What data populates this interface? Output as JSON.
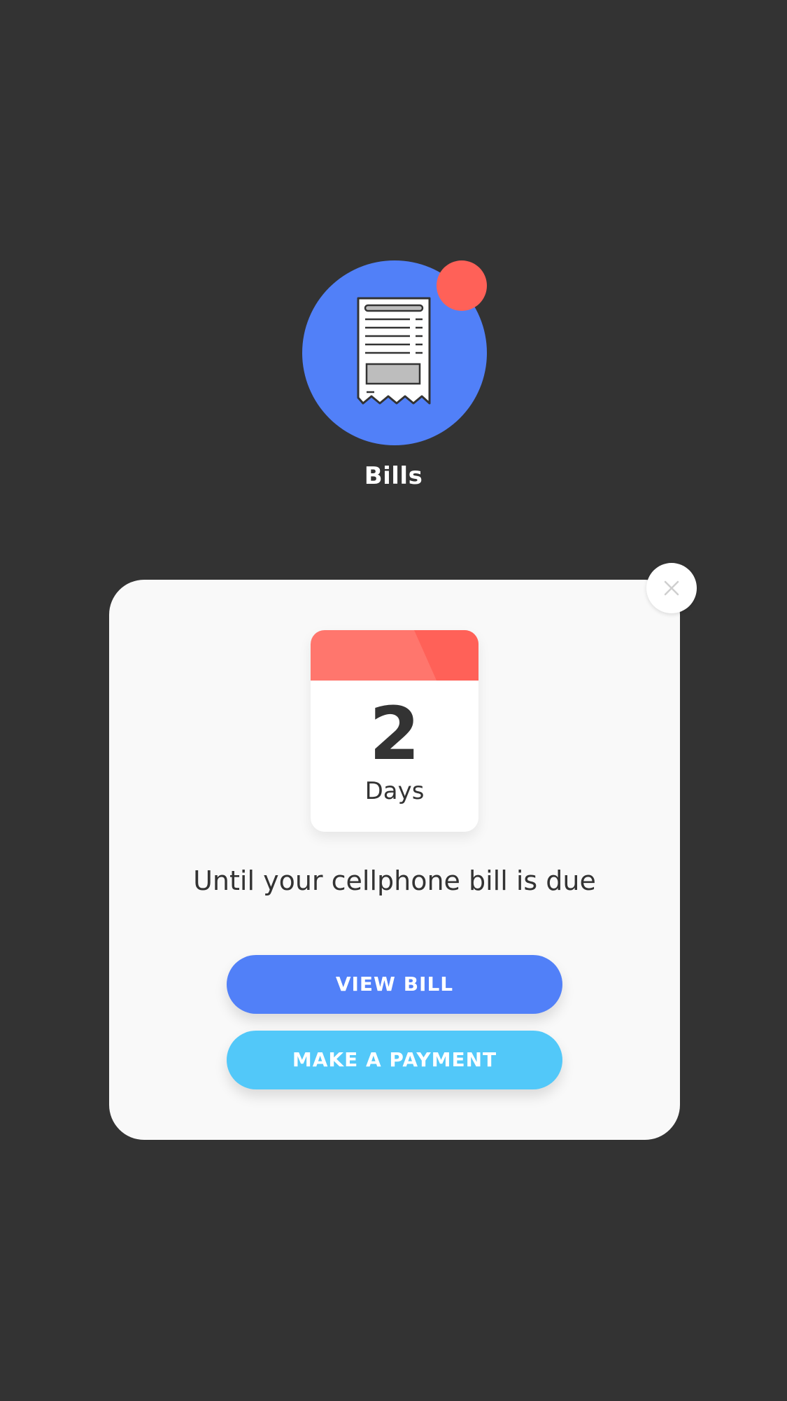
{
  "app": {
    "name": "Bills",
    "icon": "receipt-icon",
    "has_notification": true
  },
  "modal": {
    "close_icon": "close-icon",
    "calendar": {
      "number": "2",
      "unit": "Days"
    },
    "message": "Until your cellphone bill is due",
    "buttons": {
      "view_bill": "VIEW BILL",
      "make_payment": "MAKE A PAYMENT"
    }
  },
  "colors": {
    "background": "#333333",
    "primary_blue": "#5180f8",
    "light_blue": "#52c8f9",
    "alert_red": "#ff6158",
    "card": "#f9f9f9"
  }
}
